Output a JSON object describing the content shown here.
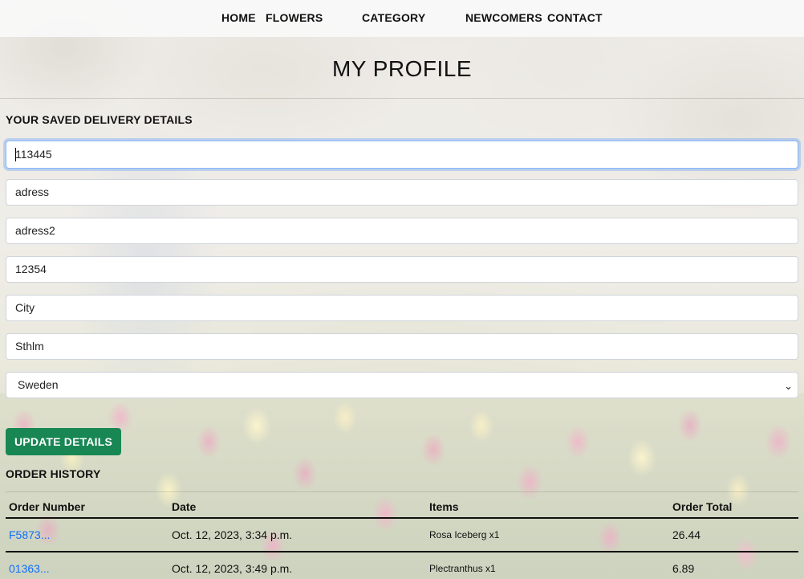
{
  "nav": {
    "items": [
      "HOME",
      "FLOWERS",
      "CATEGORY",
      "NEWCOMERS",
      "CONTACT"
    ]
  },
  "page": {
    "title": "MY PROFILE"
  },
  "delivery": {
    "section_title": "YOUR SAVED DELIVERY DETAILS",
    "fields": [
      "113445",
      "adress",
      "adress2",
      "12354",
      "City",
      "Sthlm"
    ],
    "country": "Sweden",
    "update_button": "UPDATE DETAILS"
  },
  "orders": {
    "section_title": "ORDER HISTORY",
    "headers": [
      "Order Number",
      "Date",
      "Items",
      "Order Total"
    ],
    "rows": [
      {
        "number": "F5873...",
        "date": "Oct. 12, 2023, 3:34 p.m.",
        "items": "Rosa Iceberg x1",
        "total": "26.44"
      },
      {
        "number": "01363...",
        "date": "Oct. 12, 2023, 3:49 p.m.",
        "items": "Plectranthus x1",
        "total": "6.89"
      }
    ]
  },
  "colors": {
    "button_green": "#198754",
    "link_blue": "#0d6efd",
    "focus_border": "#86b7fe"
  }
}
